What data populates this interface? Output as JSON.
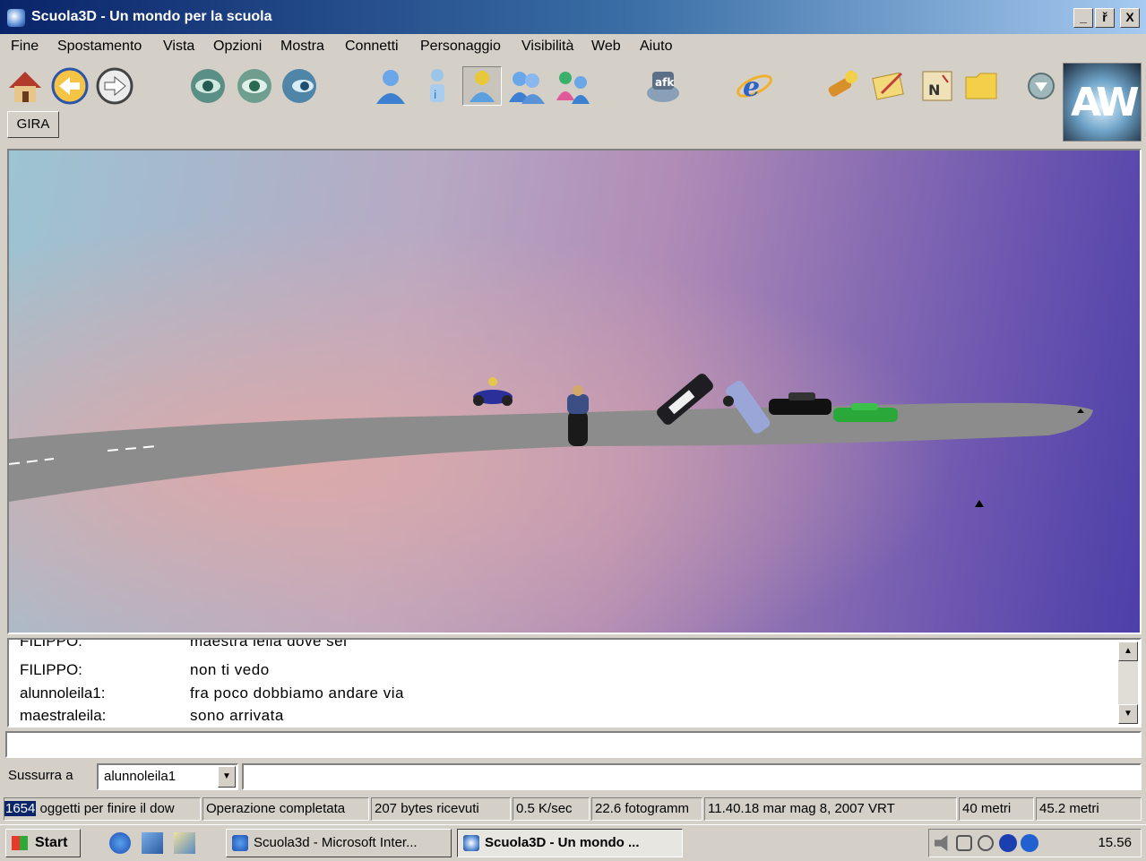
{
  "window": {
    "title": "Scuola3D - Un mondo per la scuola",
    "minimize": "_",
    "restore": "ř",
    "close": "X"
  },
  "menu": [
    "Fine",
    "Spostamento",
    "Vista",
    "Opzioni",
    "Mostra",
    "Connetti",
    "Personaggio",
    "Visibilità",
    "Web",
    "Aiuto"
  ],
  "toolbar": {
    "icons": [
      "home-icon",
      "back-icon",
      "forward-icon",
      "eye-first-person-icon",
      "eye-third-person-icon",
      "eye-front-icon",
      "avatar-icon",
      "avatar-info-icon",
      "avatar-selected-icon",
      "contacts-icon",
      "telegram-icon",
      "afk-icon",
      "web-browser-icon",
      "teleport-icon",
      "notes-icon",
      "map-icon",
      "folder-icon",
      "dropdown-icon"
    ],
    "gira_label": "GIRA",
    "logo_text": "AW"
  },
  "chat": {
    "lines": [
      {
        "name": "FILIPPO:",
        "text": "maestra leila dove sei"
      },
      {
        "name": "FILIPPO:",
        "text": " non ti vedo"
      },
      {
        "name": "alunnoleila1:",
        "text": "fra  poco dobbiamo  andare  via"
      },
      {
        "name": "maestraleila:",
        "text": "sono arrivata"
      }
    ]
  },
  "chat_input": {
    "value": ""
  },
  "whisper": {
    "label": "Sussurra a",
    "selected": "alunnoleila1",
    "value": ""
  },
  "status": {
    "count": "1654",
    "download": "oggetti per finire il dow",
    "operation": "Operazione completata",
    "bytes": "207 bytes ricevuti",
    "speed": "0.5 K/sec",
    "fps": "22.6 fotogramm",
    "datetime": "11.40.18 mar mag 8, 2007 VRT",
    "distance1": "40 metri",
    "distance2": "45.2 metri"
  },
  "taskbar": {
    "start": "Start",
    "tasks": [
      "Scuola3d - Microsoft Inter...",
      "Scuola3D - Un mondo ..."
    ],
    "clock": "15.56"
  }
}
